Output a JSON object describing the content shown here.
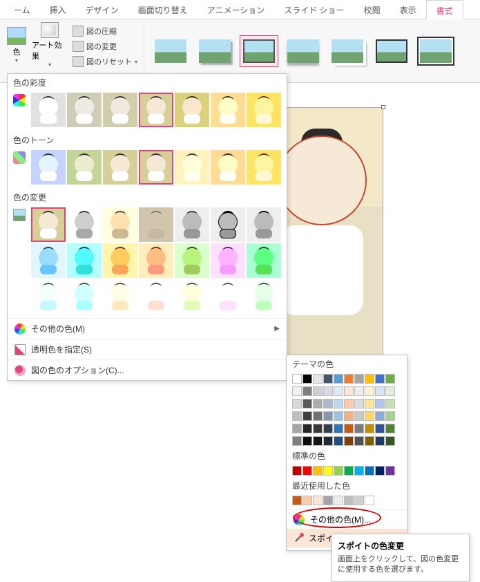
{
  "ribbon": {
    "tabs": [
      "ーム",
      "挿入",
      "デザイン",
      "画面切り替え",
      "アニメーション",
      "スライド ショー",
      "校閲",
      "表示",
      "書式"
    ],
    "active_tab": "書式",
    "color_button": "色",
    "art_effects": "アート効果",
    "compress": "図の圧縮",
    "change_pic": "図の変更",
    "reset_pic": "図のリセット"
  },
  "dropdown": {
    "section_saturation": "色の彩度",
    "section_tone": "色のトーン",
    "section_recolor": "色の変更",
    "more_colors": "その他の色(M)",
    "set_transparent": "透明色を指定(S)",
    "color_options": "図の色のオプション(C)..."
  },
  "submenu": {
    "theme_colors": "テーマの色",
    "standard_colors": "標準の色",
    "recent_colors": "最近使用した色",
    "more_colors": "その他の色(M)...",
    "eyedropper": "スポイト(E)",
    "theme_row_main": [
      "#ffffff",
      "#000000",
      "#e7e6e6",
      "#44546a",
      "#5b9bd5",
      "#ed7d31",
      "#a5a5a5",
      "#ffc000",
      "#4472c4",
      "#70ad47"
    ],
    "theme_tints": [
      [
        "#f2f2f2",
        "#7f7f7f",
        "#d0cece",
        "#d6dce4",
        "#deebf6",
        "#fbe5d5",
        "#ededed",
        "#fff2cc",
        "#dae3f3",
        "#e2efd9"
      ],
      [
        "#d8d8d8",
        "#595959",
        "#aeabab",
        "#adb9ca",
        "#bdd7ee",
        "#f7cbac",
        "#dbdbdb",
        "#fee599",
        "#b4c6e7",
        "#c5e0b3"
      ],
      [
        "#bfbfbf",
        "#3f3f3f",
        "#757070",
        "#8496b0",
        "#9cc3e5",
        "#f4b183",
        "#c9c9c9",
        "#ffd965",
        "#8eaadb",
        "#a8d08d"
      ],
      [
        "#a5a5a5",
        "#262626",
        "#3a3838",
        "#323f4f",
        "#2e75b5",
        "#c55a11",
        "#7b7b7b",
        "#bf9000",
        "#2f5496",
        "#538135"
      ],
      [
        "#7f7f7f",
        "#0c0c0c",
        "#171616",
        "#222a35",
        "#1e4e79",
        "#833c0b",
        "#525252",
        "#7f6000",
        "#1f3864",
        "#375623"
      ]
    ],
    "standard_row": [
      "#c00000",
      "#ff0000",
      "#ffc000",
      "#ffff00",
      "#92d050",
      "#00b050",
      "#00b0f0",
      "#0070c0",
      "#002060",
      "#7030a0"
    ],
    "recent_row": [
      "#c55a11",
      "#f7cbac",
      "#fbe5d5",
      "#a5a5a5",
      "#ededed",
      "#bfbfbf",
      "#d0cece",
      "#ffffff"
    ]
  },
  "tooltip": {
    "title": "スポイトの色変更",
    "body": "画面上をクリックして、図の色変更に使用する色を選びます。"
  }
}
